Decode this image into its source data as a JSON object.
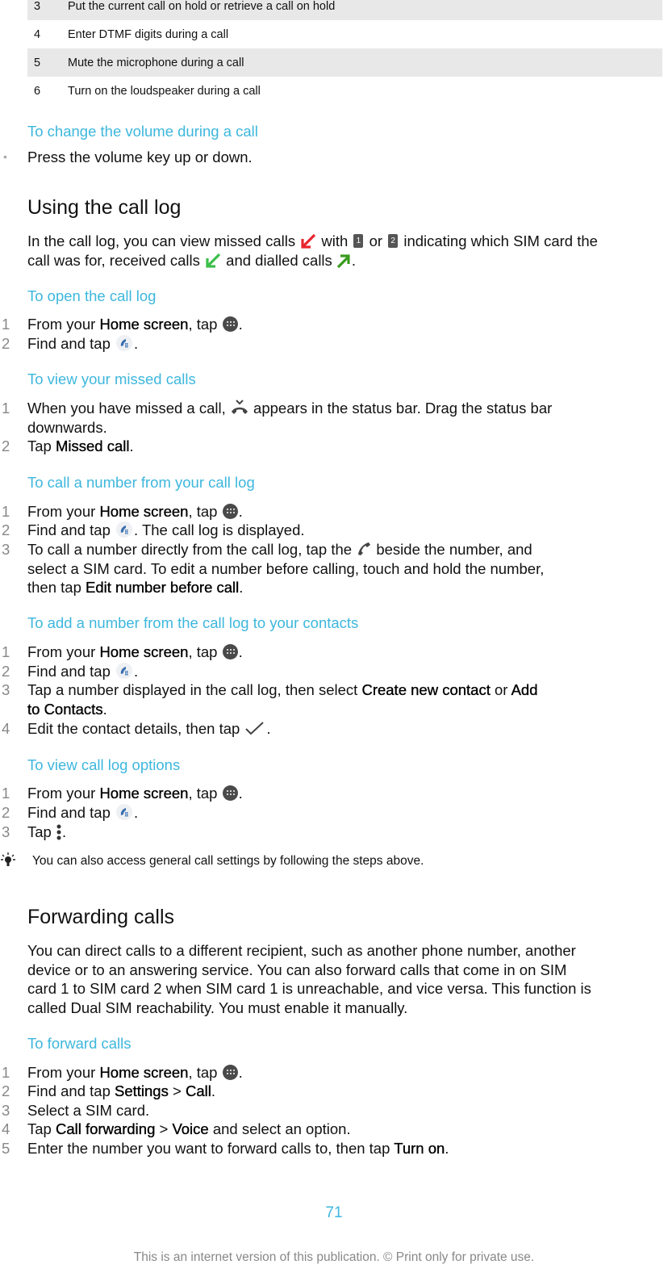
{
  "table": {
    "rows": [
      {
        "num": "3",
        "text": "Put the current call on hold or retrieve a call on hold"
      },
      {
        "num": "4",
        "text": "Enter DTMF digits during a call"
      },
      {
        "num": "5",
        "text": "Mute the microphone during a call"
      },
      {
        "num": "6",
        "text": "Turn on the loudspeaker during a call"
      }
    ]
  },
  "volume": {
    "heading": "To change the volume during a call",
    "bullet": "Press the volume key up or down."
  },
  "call_log": {
    "heading": "Using the call log",
    "intro": {
      "p1": "In the call log, you can view missed calls",
      "p2": "with",
      "p3": "or",
      "p4": "indicating which SIM card the",
      "p5": "call was for, received calls",
      "p6": "and dialled calls",
      "p7": ".",
      "sim1": "1",
      "sim2": "2"
    },
    "colors": {
      "missed": "#e8252e",
      "received": "#3cbf4a",
      "dialled": "#3a9a1e",
      "accent": "#3db7dd"
    }
  },
  "open_log": {
    "heading": "To open the call log",
    "steps": [
      {
        "n": "1",
        "a": "From your ",
        "b": "Home screen",
        "c": ", tap ",
        "d": "."
      },
      {
        "n": "2",
        "a": "Find and tap ",
        "d": "."
      }
    ]
  },
  "missed": {
    "heading": "To view your missed calls",
    "step1": {
      "n": "1",
      "a": "When you have missed a call, ",
      "b": " appears in the status bar. Drag the status bar",
      "c": "downwards."
    },
    "step2": {
      "n": "2",
      "a": "Tap ",
      "b": "Missed call",
      "c": "."
    }
  },
  "call_number": {
    "heading": "To call a number from your call log",
    "step1": {
      "n": "1",
      "a": "From your ",
      "b": "Home screen",
      "c": ", tap ",
      "d": "."
    },
    "step2": {
      "n": "2",
      "a": "Find and tap ",
      "d": ". The call log is displayed."
    },
    "step3": {
      "n": "3",
      "a": "To call a number directly from the call log, tap the ",
      "b": " beside the number, and",
      "c": "select a SIM card. To edit a number before calling, touch and hold the number,",
      "d": "then tap ",
      "e": "Edit number before call",
      "f": "."
    }
  },
  "add_contact": {
    "heading": "To add a number from the call log to your contacts",
    "step1": {
      "n": "1",
      "a": "From your ",
      "b": "Home screen",
      "c": ", tap ",
      "d": "."
    },
    "step2": {
      "n": "2",
      "a": "Find and tap ",
      "d": "."
    },
    "step3": {
      "n": "3",
      "a": "Tap a number displayed in the call log, then select ",
      "b": "Create new contact",
      "c": " or ",
      "d": "Add",
      "e": "to Contacts",
      "f": "."
    },
    "step4": {
      "n": "4",
      "a": "Edit the contact details, then tap ",
      "d": "."
    }
  },
  "log_options": {
    "heading": "To view call log options",
    "step1": {
      "n": "1",
      "a": "From your ",
      "b": "Home screen",
      "c": ", tap ",
      "d": "."
    },
    "step2": {
      "n": "2",
      "a": "Find and tap ",
      "d": "."
    },
    "step3": {
      "n": "3",
      "a": "Tap ",
      "d": "."
    },
    "tip": "You can also access general call settings by following the steps above."
  },
  "forwarding": {
    "heading": "Forwarding calls",
    "lines": [
      "You can direct calls to a different recipient, such as another phone number, another",
      "device or to an answering service. You can also forward calls that come in on SIM",
      "card 1 to SIM card 2 when SIM card 1 is unreachable, and vice versa. This function is",
      "called Dual SIM reachability. You must enable it manually."
    ]
  },
  "forward_calls": {
    "heading": "To forward calls",
    "step1": {
      "n": "1",
      "a": "From your ",
      "b": "Home screen",
      "c": ", tap ",
      "d": "."
    },
    "step2": {
      "n": "2",
      "a": "Find and tap ",
      "b": "Settings",
      "c": " > ",
      "d": "Call",
      "e": "."
    },
    "step3": {
      "n": "3",
      "a": "Select a SIM card."
    },
    "step4": {
      "n": "4",
      "a": "Tap ",
      "b": "Call forwarding",
      "c": " > ",
      "d": "Voice",
      "e": " and select an option."
    },
    "step5": {
      "n": "5",
      "a": "Enter the number you want to forward calls to, then tap ",
      "b": "Turn on",
      "c": "."
    }
  },
  "footer": {
    "page_number": "71",
    "notice": "This is an internet version of this publication. © Print only for private use."
  }
}
